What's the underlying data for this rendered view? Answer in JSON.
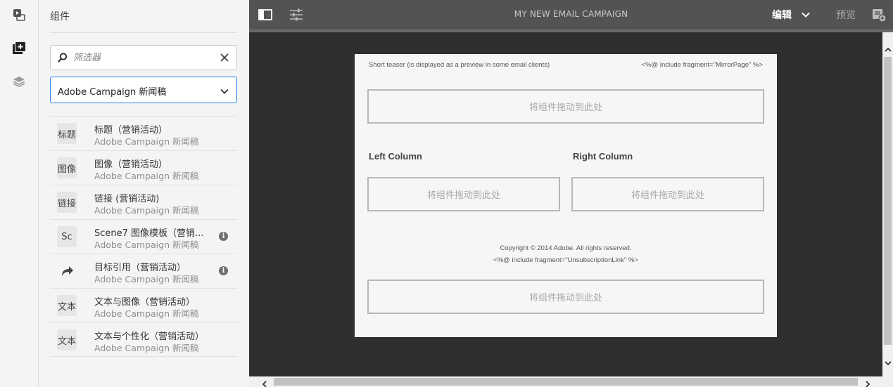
{
  "panel": {
    "title": "组件",
    "search_placeholder": "筛选器",
    "group_select": "Adobe Campaign 新闻稿"
  },
  "components": [
    {
      "thumb": "标题",
      "title": "标题（营销活动）",
      "group": "Adobe Campaign 新闻稿",
      "info": false
    },
    {
      "thumb": "图像",
      "title": "图像（营销活动）",
      "group": "Adobe Campaign 新闻稿",
      "info": false
    },
    {
      "thumb": "链接",
      "title": "链接 (营销活动)",
      "group": "Adobe Campaign 新闻稿",
      "info": false
    },
    {
      "thumb": "Sc",
      "title": "Scene7 图像模板（营销...",
      "group": "Adobe Campaign 新闻稿",
      "info": true
    },
    {
      "thumb": "",
      "title": "目标引用（营销活动）",
      "group": "Adobe Campaign 新闻稿",
      "info": true
    },
    {
      "thumb": "文本",
      "title": "文本与图像（营销活动）",
      "group": "Adobe Campaign 新闻稿",
      "info": false
    },
    {
      "thumb": "文本",
      "title": "文本与个性化（营销活动）",
      "group": "Adobe Campaign 新闻稿",
      "info": false
    }
  ],
  "topbar": {
    "title": "MY NEW EMAIL CAMPAIGN",
    "edit_label": "编辑",
    "preview_label": "预览"
  },
  "email": {
    "teaser": "Short teaser (is displayed as a preview in some email clients)",
    "mirror": "<%@ include fragment=\"MirrorPage\" %>",
    "drop_label": "将组件拖动到此处",
    "left_column": "Left Column",
    "right_column": "Right Column",
    "copyright": "Copyright © 2014 Adobe. All rights reserved.",
    "unsubscribe": "<%@ include fragment=\"UnsubscriptionLink\" %>"
  },
  "colors": {
    "accent": "#2680eb",
    "topbar": "#535353",
    "canvas": "#2f2f2f"
  }
}
